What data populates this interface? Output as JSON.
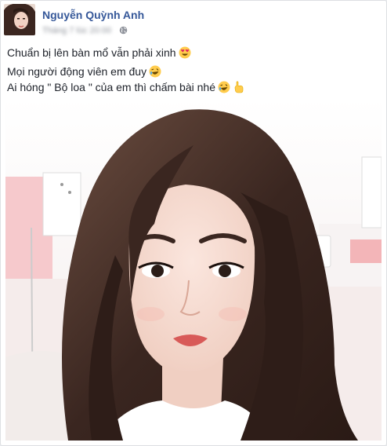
{
  "post": {
    "author": "Nguyễn Quỳnh Anh",
    "timestamp": "Tháng 7 lúc 20:00",
    "privacy_icon": "globe-icon",
    "lines": [
      "Chuẩn bị lên bàn mổ vẫn phải xinh",
      "Mọi người động viên em đuy",
      "Ai hóng \" Bộ loa \" của em thì chấm bài nhé"
    ],
    "emojis": [
      "heart-eyes-emoji",
      "rofl-emoji",
      "rofl-emoji",
      "pointing-hand-emoji"
    ]
  },
  "colors": {
    "author": "#365899",
    "text": "#1d2129",
    "meta": "#90949c",
    "card_border": "#dddfe2",
    "background": "#e9ebee"
  }
}
